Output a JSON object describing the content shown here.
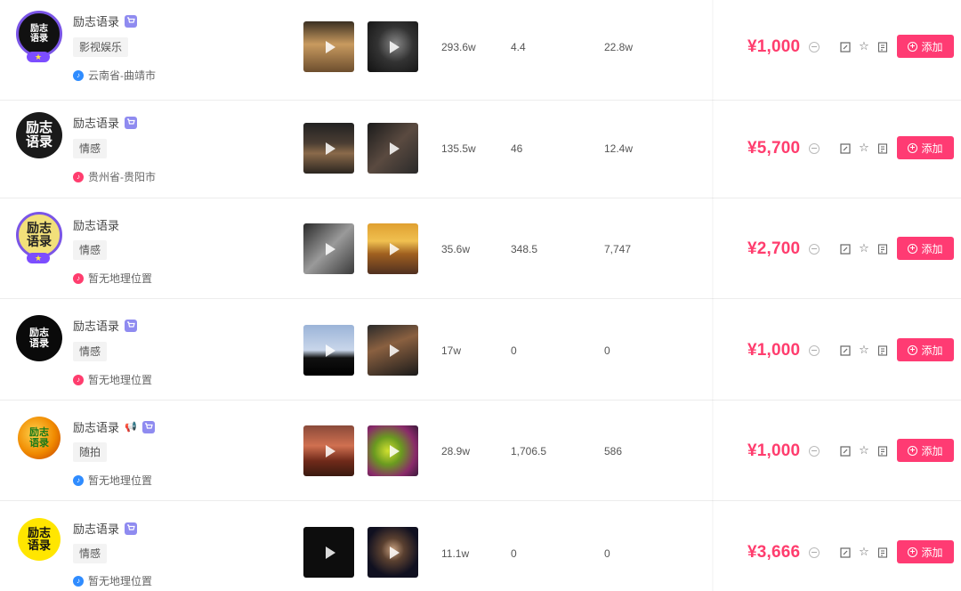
{
  "columns_note": "",
  "rows": [
    {
      "avatar_text": "励志\n语录",
      "avatar_badge": "",
      "name": "励志语录",
      "has_shop_icon": true,
      "tag": "影视娱乐",
      "location": "云南省-曲靖市",
      "location_platform": "douyin-blue",
      "stat1": "293.6w",
      "stat2": "4.4",
      "stat3": "22.8w",
      "price": "¥1,000",
      "add_label": "添加"
    },
    {
      "avatar_text": "励志\n语录",
      "avatar_badge": "",
      "name": "励志语录",
      "has_shop_icon": true,
      "tag": "情感",
      "location": "贵州省-贵阳市",
      "location_platform": "red",
      "stat1": "135.5w",
      "stat2": "46",
      "stat3": "12.4w",
      "price": "¥5,700",
      "add_label": "添加"
    },
    {
      "avatar_text": "励志\n语录",
      "avatar_badge": "",
      "name": "励志语录",
      "has_shop_icon": false,
      "tag": "情感",
      "location": "暂无地理位置",
      "location_platform": "red",
      "stat1": "35.6w",
      "stat2": "348.5",
      "stat3": "7,747",
      "price": "¥2,700",
      "add_label": "添加"
    },
    {
      "avatar_text": "励志\n语录",
      "avatar_badge": "",
      "name": "励志语录",
      "has_shop_icon": true,
      "tag": "情感",
      "location": "暂无地理位置",
      "location_platform": "red",
      "stat1": "17w",
      "stat2": "0",
      "stat3": "0",
      "price": "¥1,000",
      "add_label": "添加"
    },
    {
      "avatar_text": "励志\n语录",
      "avatar_badge": "",
      "name": "励志语录",
      "has_shop_icon": true,
      "tag": "随拍",
      "location": "暂无地理位置",
      "location_platform": "douyin-blue",
      "stat1": "28.9w",
      "stat2": "1,706.5",
      "stat3": "586",
      "price": "¥1,000",
      "add_label": "添加"
    },
    {
      "avatar_text": "励志\n语录",
      "avatar_badge": "",
      "name": "励志语录",
      "has_shop_icon": true,
      "tag": "情感",
      "location": "暂无地理位置",
      "location_platform": "douyin-blue",
      "stat1": "11.1w",
      "stat2": "0",
      "stat3": "0",
      "price": "¥3,666",
      "add_label": "添加"
    }
  ],
  "colors": {
    "accent": "#ff3b73",
    "price": "#ff3d6e",
    "shop_icon": "#8f8bf0",
    "location_blue": "#2f8cff",
    "location_red": "#ff3d6e"
  }
}
